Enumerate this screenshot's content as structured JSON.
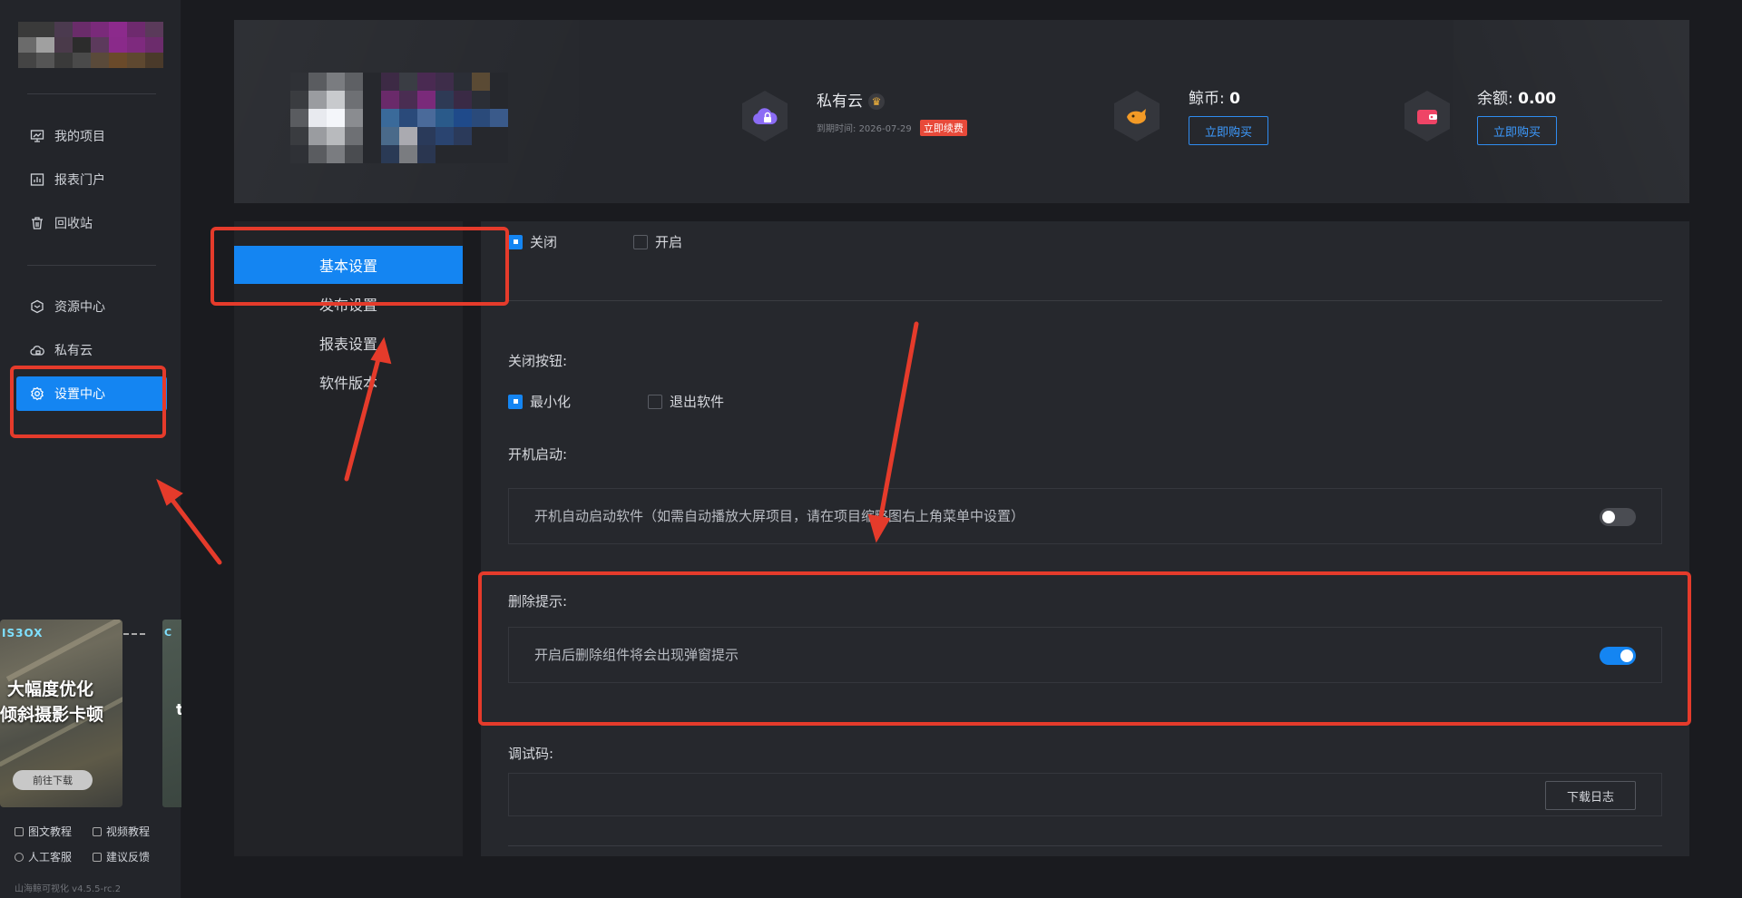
{
  "colors": {
    "accent": "#1485f2",
    "danger": "#e84a3a",
    "annotation": "#e53b2b",
    "background": "#1a1b1f",
    "panel": "#26282d"
  },
  "sidebar": {
    "nav": [
      {
        "label": "我的项目",
        "icon": "monitor-chart-icon"
      },
      {
        "label": "报表门户",
        "icon": "bar-chart-icon"
      },
      {
        "label": "回收站",
        "icon": "trash-icon"
      },
      {
        "label": "资源中心",
        "icon": "cube-icon"
      },
      {
        "label": "私有云",
        "icon": "cloud-lock-icon"
      },
      {
        "label": "设置中心",
        "icon": "gear-icon",
        "active": true
      }
    ],
    "banner": {
      "brand": "IS3OX",
      "title_line1": "大幅度优化",
      "title_line2": "倾斜摄影卡顿",
      "download": "前往下载"
    },
    "links": [
      "图文教程",
      "视频教程",
      "人工客服",
      "建议反馈"
    ],
    "version": "山海鲸可视化 v4.5.5-rc.2"
  },
  "header": {
    "private_cloud": {
      "label": "私有云",
      "expire_prefix": "到期时间:",
      "expire_date": "2026-07-29",
      "renew": "立即续费"
    },
    "coins": {
      "label": "鲸币:",
      "value": "0",
      "buy": "立即购买"
    },
    "balance": {
      "label": "余额:",
      "value": "0.00",
      "buy": "立即购买"
    }
  },
  "tabs": [
    {
      "label": "基本设置",
      "active": true
    },
    {
      "label": "发布设置"
    },
    {
      "label": "报表设置"
    },
    {
      "label": "软件版本"
    }
  ],
  "settings": {
    "top_options": [
      {
        "label": "关闭",
        "checked": true
      },
      {
        "label": "开启",
        "checked": false
      }
    ],
    "close_button": {
      "label": "关闭按钮:",
      "options": [
        {
          "label": "最小化",
          "checked": true
        },
        {
          "label": "退出软件",
          "checked": false
        }
      ]
    },
    "autostart": {
      "label": "开机启动:",
      "text": "开机自动启动软件（如需自动播放大屏项目，请在项目缩略图右上角菜单中设置）",
      "on": false
    },
    "delete_prompt": {
      "label": "删除提示:",
      "text": "开启后删除组件将会出现弹窗提示",
      "on": true
    },
    "debug": {
      "label": "调试码:",
      "button": "下载日志"
    }
  }
}
